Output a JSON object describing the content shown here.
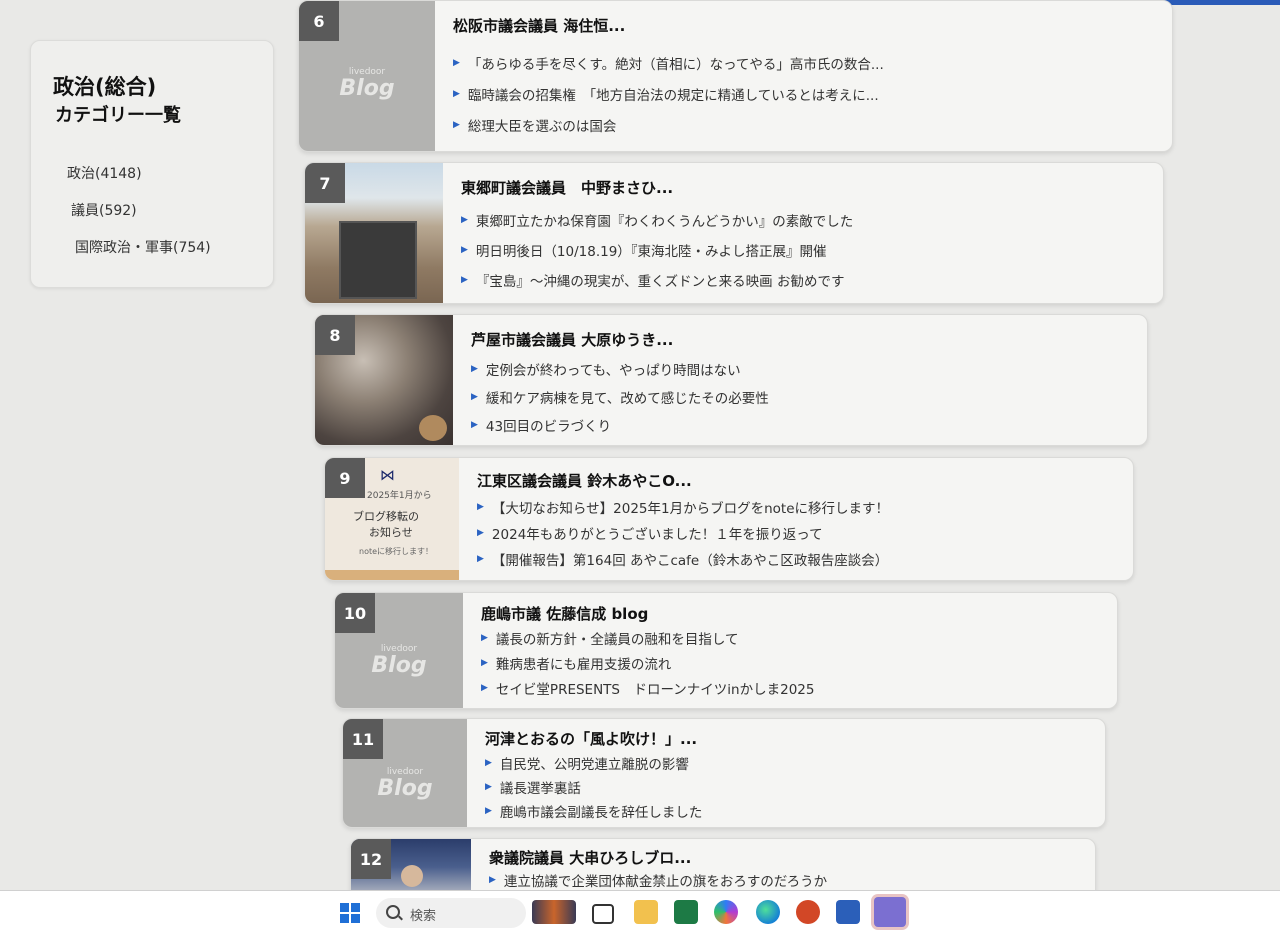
{
  "sidebar": {
    "title": "政治(総合)",
    "subtitle": "カテゴリー一覧",
    "categories": [
      "政治(4148)",
      "議員(592)",
      "国際政治・軍事(754)"
    ]
  },
  "ranking": [
    {
      "rank": "6",
      "title": "松阪市議会議員 海住恒...",
      "posts": [
        "「あらゆる手を尽くす。絶対（首相に）なってやる」高市氏の数合...",
        "臨時議会の招集権　「地方自治法の規定に精通しているとは考えに...",
        "総理大臣を選ぶのは国会"
      ],
      "thumb": "livedoor-blog"
    },
    {
      "rank": "7",
      "title": "東郷町議会議員　中野まさひ...",
      "posts": [
        "東郷町立たかね保育園『わくわくうんどうかい』の素敵でした",
        "明日明後日（10/18.19）『東海北陸・みよし搭正展』開催",
        "『宝島』〜沖縄の現実が、重くズドンと来る映画 お勧めです"
      ],
      "thumb": "photo"
    },
    {
      "rank": "8",
      "title": "芦屋市議会議員 大原ゆうき...",
      "posts": [
        "定例会が終わっても、やっぱり時間はない",
        "緩和ケア病棟を見て、改めて感じたその必要性",
        "43回目のビラづくり"
      ],
      "thumb": "photo"
    },
    {
      "rank": "9",
      "title": "江東区議会議員 鈴木あやこO...",
      "posts": [
        "【大切なお知らせ】2025年1月からブログをnoteに移行します！",
        "2024年もありがとうございました！１年を振り返って",
        "【開催報告】第164回 あやこcafe（鈴木あやこ区政報告座談会）"
      ],
      "thumb": "notice"
    },
    {
      "rank": "10",
      "title": "鹿嶋市議 佐藤信成 blog",
      "posts": [
        "議長の新方針・全議員の融和を目指して",
        "難病患者にも雇用支援の流れ",
        "セイビ堂PRESENTS　ドローンナイツinかしま2025"
      ],
      "thumb": "livedoor-blog"
    },
    {
      "rank": "11",
      "title": "河津とおるの「風よ吹け！」...",
      "posts": [
        "自民党、公明党連立離脱の影響",
        "議長選挙裏話",
        "鹿嶋市議会副議長を辞任しました"
      ],
      "thumb": "livedoor-blog"
    },
    {
      "rank": "12",
      "title": "衆議院議員 大串ひろしブロ...",
      "posts": [
        "連立協議で企業団体献金禁止の旗をおろすのだろうか"
      ],
      "thumb": "photo"
    }
  ],
  "thumb_text": {
    "livedoor": "livedoor",
    "blog": "Blog",
    "notice_year": "2025年1月から",
    "notice_line1": "ブログ移転の",
    "notice_line2": "お知らせ",
    "notice_line3": "noteに移行します！"
  },
  "taskbar": {
    "search_placeholder": "検索",
    "apps": [
      "file-explorer-icon",
      "excel-icon",
      "copilot-icon",
      "edge-icon",
      "powerpoint-icon",
      "word-icon",
      "teams-icon"
    ]
  }
}
